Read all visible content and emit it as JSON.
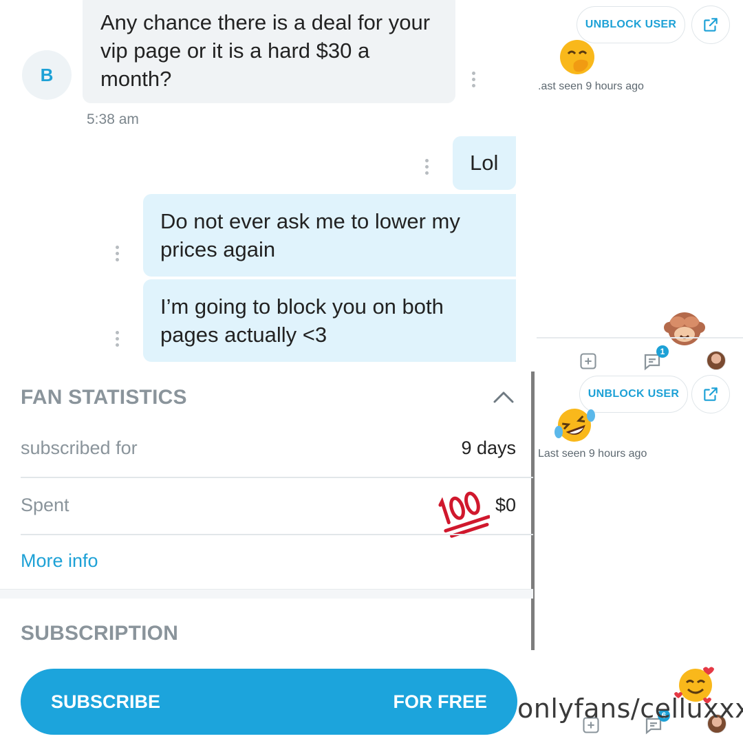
{
  "chat": {
    "sender_initial": "B",
    "incoming_message": "Any chance there is a deal for your vip page or it is a hard $30 a month?",
    "incoming_time": "5:38 am",
    "outgoing_messages": [
      "Lol",
      "Do not ever ask me to lower my prices again",
      "I’m going to block you on both pages actually <3"
    ]
  },
  "profile_panels": [
    {
      "unblock_label": "UNBLOCK USER",
      "last_seen": ".ast seen 9 hours ago",
      "icon": "share-icon",
      "emoji": "face-with-hand-over-mouth"
    },
    {
      "unblock_label": "UNBLOCK USER",
      "last_seen": "Last seen 9 hours ago",
      "icon": "share-icon",
      "emoji": "rolling-on-floor-laughing",
      "notification_count": "1"
    }
  ],
  "fan_statistics": {
    "title": "FAN STATISTICS",
    "rows": [
      {
        "label": "subscribed for",
        "value": "9 days"
      },
      {
        "label": "Spent",
        "value": "$0"
      }
    ],
    "more_info": "More info"
  },
  "subscription": {
    "title": "SUBSCRIPTION",
    "button_left": "SUBSCRIBE",
    "button_right": "FOR FREE"
  },
  "bottom_bar": {
    "notification_count": "6"
  },
  "watermark": "onlyfans/celluxxx",
  "decorations": [
    "hundred-points-emoji",
    "see-no-evil-monkey-emoji",
    "smiling-face-with-hearts-emoji"
  ],
  "colors": {
    "accent": "#1ca4dc",
    "outgoing_bubble": "#e0f3fc",
    "incoming_bubble": "#f0f3f5",
    "muted_text": "#8a949b"
  }
}
